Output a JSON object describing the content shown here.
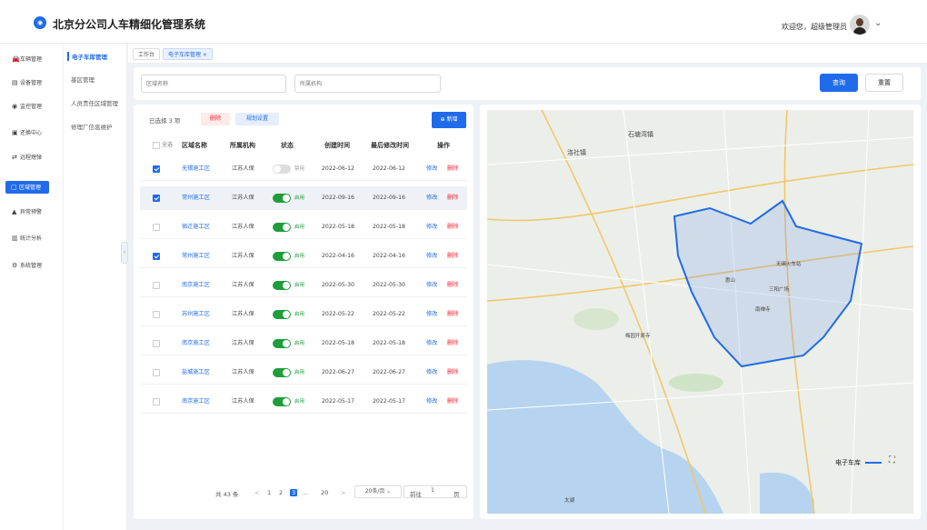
{
  "header": {
    "title": "北京分公司人车精细化管理系统",
    "welcome": "欢迎您，超级管理员"
  },
  "sidebar": {
    "items": [
      {
        "label": "车辆管理",
        "icon": "car-icon",
        "glyph": "🚘"
      },
      {
        "label": "设备管理",
        "icon": "device-icon",
        "glyph": "▤"
      },
      {
        "label": "监控管理",
        "icon": "monitor-icon",
        "glyph": "◉"
      },
      {
        "label": "还换中心",
        "icon": "exchange-icon",
        "glyph": "▣"
      },
      {
        "label": "远程熄弹",
        "icon": "remote-icon",
        "glyph": "⇄"
      },
      {
        "label": "区域管理",
        "icon": "area-icon",
        "glyph": "▢"
      },
      {
        "label": "异常预警",
        "icon": "alert-icon",
        "glyph": "▲"
      },
      {
        "label": "统计分析",
        "icon": "stats-icon",
        "glyph": "▥"
      },
      {
        "label": "系统管理",
        "icon": "system-icon",
        "glyph": "⚙"
      }
    ]
  },
  "subnav": {
    "items": [
      "电子车库管理",
      "基区管理",
      "人员责任区域管理",
      "修理厂信息维护"
    ]
  },
  "tabs": [
    {
      "label": "工作台"
    },
    {
      "label": "电子车库管理 ×"
    }
  ],
  "filter": {
    "area_placeholder": "区域名称",
    "org_placeholder": "所属机构",
    "query": "查询",
    "reset": "重置"
  },
  "toolbar": {
    "selected": "已选择 3 项",
    "delete": "删除",
    "plan": "规划设置",
    "add": "新增"
  },
  "table": {
    "headers": {
      "all": "全选",
      "name": "区域名称",
      "org": "所属机构",
      "status": "状态",
      "created": "创建时间",
      "modified": "最后修改时间",
      "ops": "操作"
    },
    "rows": [
      {
        "name": "无锡施工区",
        "org": "江苏人保",
        "status": "禁用",
        "created": "2022-06-12",
        "modified": "2022-06-12",
        "edit": "修改",
        "del": "删除",
        "checked": true,
        "on": false
      },
      {
        "name": "常州施工区",
        "org": "江苏人保",
        "status": "启用",
        "created": "2022-09-16",
        "modified": "2022-09-16",
        "edit": "修改",
        "del": "删除",
        "checked": true,
        "on": true
      },
      {
        "name": "宿迁施工区",
        "org": "江苏人保",
        "status": "启用",
        "created": "2022-05-18",
        "modified": "2022-05-18",
        "edit": "修改",
        "del": "删除",
        "checked": false,
        "on": true
      },
      {
        "name": "常州施工区",
        "org": "江苏人保",
        "status": "启用",
        "created": "2022-04-16",
        "modified": "2022-04-16",
        "edit": "修改",
        "del": "删除",
        "checked": true,
        "on": true
      },
      {
        "name": "南京施工区",
        "org": "江苏人保",
        "status": "启用",
        "created": "2022-05-30",
        "modified": "2022-05-30",
        "edit": "修改",
        "del": "删除",
        "checked": false,
        "on": true
      },
      {
        "name": "苏州施工区",
        "org": "江苏人保",
        "status": "启用",
        "created": "2022-05-22",
        "modified": "2022-05-22",
        "edit": "修改",
        "del": "删除",
        "checked": false,
        "on": true
      },
      {
        "name": "南京施工区",
        "org": "江苏人保",
        "status": "启用",
        "created": "2022-05-18",
        "modified": "2022-05-18",
        "edit": "修改",
        "del": "删除",
        "checked": false,
        "on": true
      },
      {
        "name": "盐城施工区",
        "org": "江苏人保",
        "status": "启用",
        "created": "2022-06-27",
        "modified": "2022-06-27",
        "edit": "修改",
        "del": "删除",
        "checked": false,
        "on": true
      },
      {
        "name": "南京施工区",
        "org": "江苏人保",
        "status": "启用",
        "created": "2022-05-17",
        "modified": "2022-05-17",
        "edit": "修改",
        "del": "删除",
        "checked": false,
        "on": true
      }
    ]
  },
  "pagination": {
    "total": "共 43 条",
    "prev": "<",
    "pages": [
      "1",
      "2",
      "3",
      "...",
      "20"
    ],
    "current": "3",
    "next": ">",
    "size": "20条/页",
    "goto": "前往",
    "goto_page": "1",
    "page_unit": "页"
  },
  "map": {
    "labels": [
      "石塘湾镇",
      "洛社镇",
      "惠山",
      "无锡火车站",
      "三阳广场",
      "南禅寺",
      "梅园开原寺",
      "太湖",
      "电子车库"
    ],
    "legend": "电子车库",
    "colors": {
      "fence": "#1f6bea",
      "fence_fill": "rgba(80,130,230,0.18)",
      "water": "#b6d4ef"
    }
  },
  "colors": {
    "primary": "#1f6bea",
    "danger": "#f5222d",
    "success": "#1f9d3a"
  }
}
